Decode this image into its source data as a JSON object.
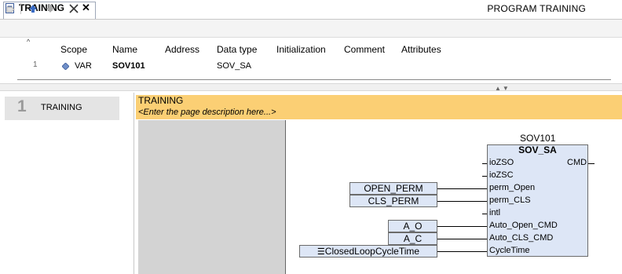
{
  "tab": {
    "label": "TRAINING",
    "close": "✕"
  },
  "toolbar": {
    "program_title": "PROGRAM TRAINING"
  },
  "declarations": {
    "columns": [
      "Scope",
      "Name",
      "Address",
      "Data type",
      "Initialization",
      "Comment",
      "Attributes"
    ],
    "rows": [
      {
        "num": "1",
        "scope": "VAR",
        "name": "SOV101",
        "address": "",
        "data_type": "SOV_SA",
        "initialization": "",
        "comment": "",
        "attributes": ""
      }
    ]
  },
  "pages": [
    {
      "number": "1",
      "name": "TRAINING"
    }
  ],
  "page": {
    "title": "TRAINING",
    "description": "<Enter the page description here...>",
    "header_color": "#fbcf74"
  },
  "block": {
    "instance": "SOV101",
    "type": "SOV_SA",
    "inputs": [
      "ioZSO",
      "ioZSC",
      "perm_Open",
      "perm_CLS",
      "intl",
      "Auto_Open_CMD",
      "Auto_CLS_CMD",
      "CycleTime"
    ],
    "outputs": [
      "CMD"
    ],
    "fill_color": "#dde6f6"
  },
  "variables": {
    "open_perm": "OPEN_PERM",
    "cls_perm": "CLS_PERM",
    "a_o": "A_O",
    "a_c": "A_C",
    "cycle_time": "ClosedLoopCycleTime"
  }
}
